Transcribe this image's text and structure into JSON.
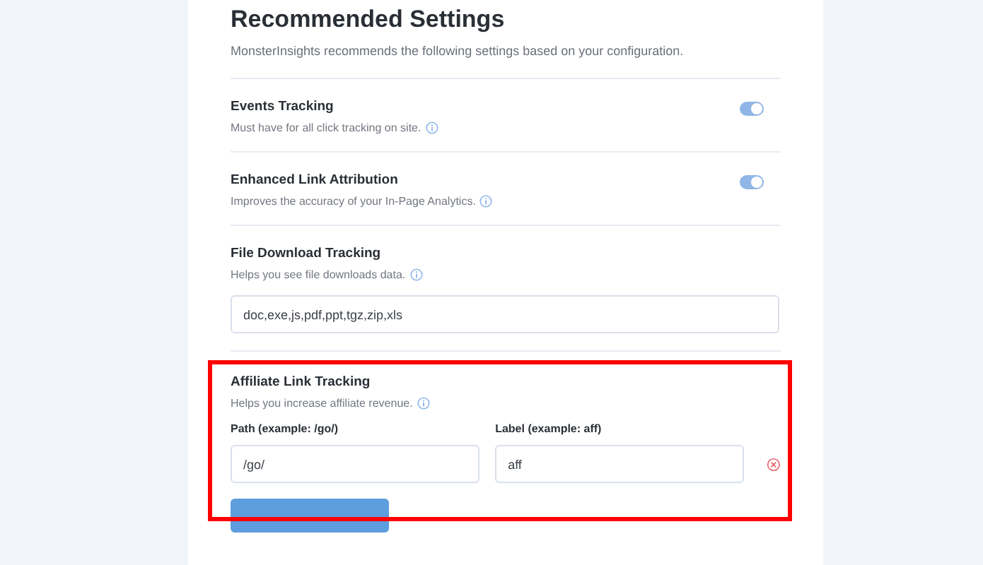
{
  "header": {
    "title": "Recommended Settings",
    "description": "MonsterInsights recommends the following settings based on your configuration."
  },
  "settings": [
    {
      "kind": "toggle",
      "title": "Events Tracking",
      "description": "Must have for all click tracking on site.",
      "on": true
    },
    {
      "kind": "toggle",
      "title": "Enhanced Link Attribution",
      "description": "Improves the accuracy of your In-Page Analytics.",
      "on": true
    },
    {
      "kind": "text",
      "title": "File Download Tracking",
      "description": "Helps you see file downloads data.",
      "value": "doc,exe,js,pdf,ppt,tgz,zip,xls"
    }
  ],
  "affiliate": {
    "title": "Affiliate Link Tracking",
    "description": "Helps you increase affiliate revenue.",
    "path_label": "Path (example: /go/)",
    "label_label": "Label (example: aff)",
    "path_value": "/go/",
    "label_value": "aff",
    "highlighted": true
  }
}
